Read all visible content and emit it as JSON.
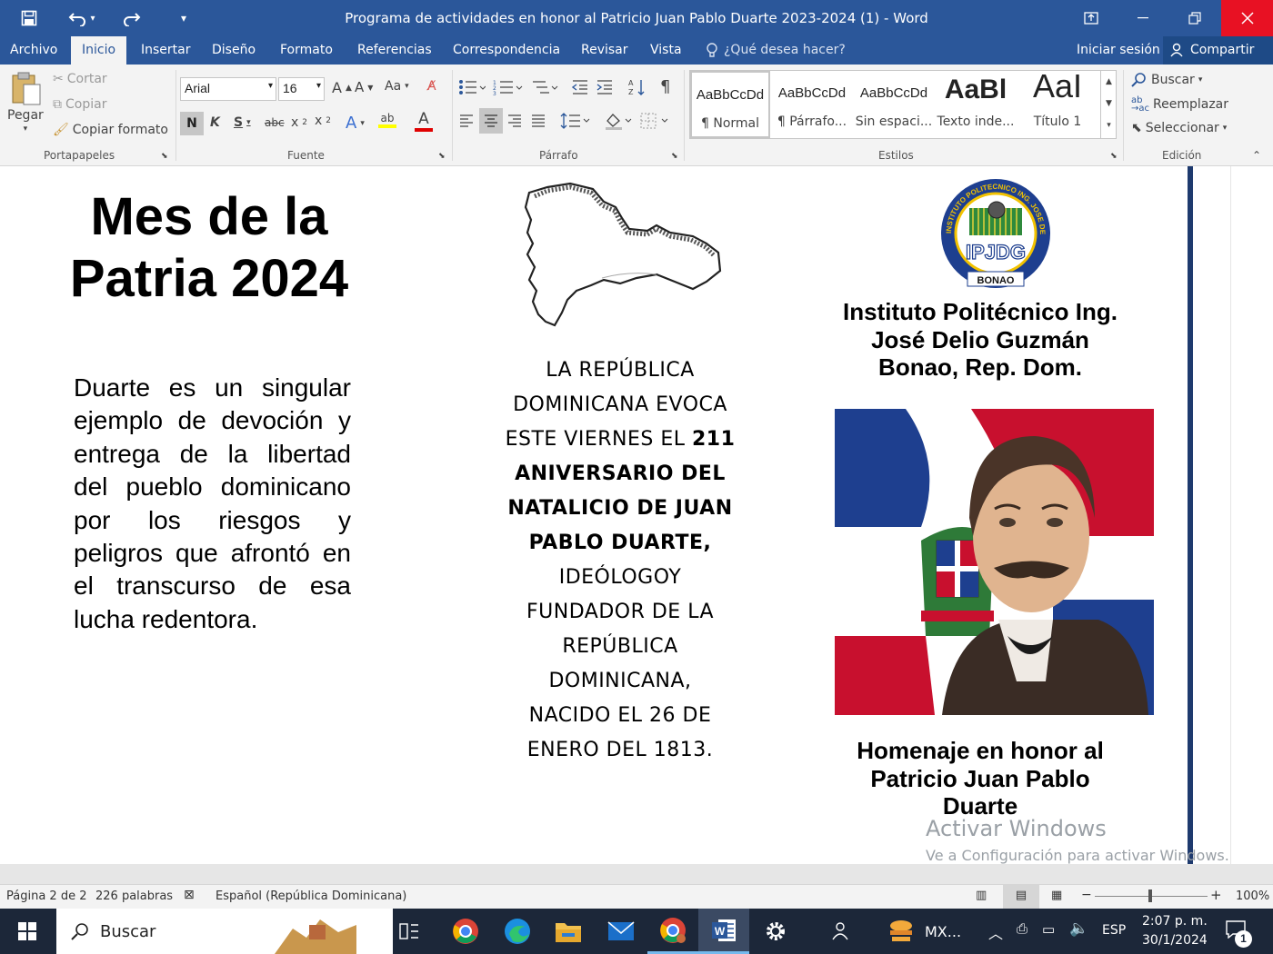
{
  "window": {
    "title": "Programa de actividades en honor al Patricio Juan Pablo Duarte 2023-2024 (1) - Word",
    "signin": "Iniciar sesión",
    "share": "Compartir"
  },
  "tabs": [
    "Archivo",
    "Inicio",
    "Insertar",
    "Diseño",
    "Formato",
    "Referencias",
    "Correspondencia",
    "Revisar",
    "Vista"
  ],
  "tellme": "¿Qué desea hacer?",
  "ribbon": {
    "clipboard": {
      "paste": "Pegar",
      "cut": "Cortar",
      "copy": "Copiar",
      "format_painter": "Copiar formato",
      "label": "Portapapeles"
    },
    "font": {
      "name": "Arial",
      "size": "16",
      "label": "Fuente",
      "change_case": "Aa",
      "bold": "N",
      "italic": "K",
      "underline": "S",
      "strike": "abc"
    },
    "paragraph": {
      "label": "Párrafo"
    },
    "styles": {
      "label": "Estilos",
      "items": [
        {
          "preview": "AaBbCcDd",
          "name": "¶ Normal"
        },
        {
          "preview": "AaBbCcDd",
          "name": "¶ Párrafo..."
        },
        {
          "preview": "AaBbCcDd",
          "name": "Sin espaci..."
        },
        {
          "preview": "AaBl",
          "name": "Texto inde..."
        },
        {
          "preview": "AaI",
          "name": "Título 1"
        }
      ]
    },
    "editing": {
      "find": "Buscar",
      "replace": "Reemplazar",
      "select": "Seleccionar",
      "label": "Edición"
    }
  },
  "document": {
    "heading_line1": "Mes de la",
    "heading_line2": "Patria 2024",
    "left_paragraph": "Duarte es un singular ejemplo de devoción y entrega de la libertad del pueblo dominicano por los riesgos y peligros que afrontó en el transcurso de esa lucha redentora.",
    "center_text_lines": [
      {
        "normal": "LA REPÚBLICA",
        "bold": ""
      },
      {
        "normal": "DOMINICANA EVOCA",
        "bold": ""
      },
      {
        "normal": "ESTE VIERNES EL ",
        "bold": "211"
      },
      {
        "normal": "",
        "bold": "ANIVERSARIO DEL"
      },
      {
        "normal": "",
        "bold": "NATALICIO DE JUAN"
      },
      {
        "normal": "",
        "bold": "PABLO DUARTE,"
      },
      {
        "normal": "IDEÓLOGOY",
        "bold": ""
      },
      {
        "normal": "FUNDADOR DE LA",
        "bold": ""
      },
      {
        "normal": "REPÚBLICA",
        "bold": ""
      },
      {
        "normal": "DOMINICANA,",
        "bold": ""
      },
      {
        "normal": "NACIDO EL 26 DE",
        "bold": ""
      },
      {
        "normal": "ENERO DEL 1813.",
        "bold": ""
      }
    ],
    "logo_top": "INSTITUTO POLITECNICO ING. JOSE DELIO GUZMAN",
    "logo_center": "IPJDG",
    "logo_bottom": "BONAO",
    "institute_line1": "Instituto Politécnico Ing.",
    "institute_line2": "José Delio Guzmán",
    "institute_line3": "Bonao, Rep. Dom.",
    "homage_line1": "Homenaje en honor al",
    "homage_line2": "Patricio Juan Pablo",
    "homage_line3": "Duarte",
    "watermark_line1": "Activar Windows",
    "watermark_line2": "Ve a Configuración para activar Windows."
  },
  "status": {
    "page": "Página 2 de 2",
    "words": "226 palabras",
    "language": "Español (República Dominicana)",
    "zoom": "100%"
  },
  "taskbar": {
    "search": "Buscar",
    "app_label": "MX...",
    "lang": "ESP",
    "time": "2:07 p. m.",
    "date": "30/1/2024",
    "notif": "1"
  },
  "colors": {
    "word_blue": "#2b579a",
    "taskbar": "#1c2739",
    "flag_blue": "#1e3f8f",
    "flag_red": "#c8102e"
  }
}
